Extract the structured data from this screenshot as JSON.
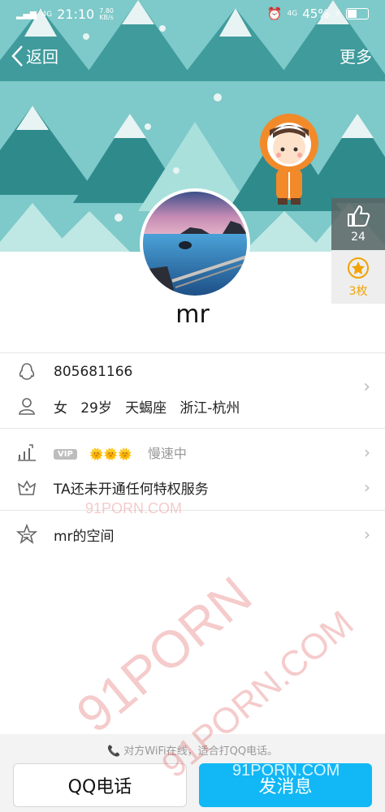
{
  "status_bar": {
    "network": "4G",
    "time": "21:10",
    "speed_value": "7.80",
    "speed_unit": "KB/s",
    "network_right": "4G",
    "battery": "45%"
  },
  "nav": {
    "back_label": "返回",
    "more_label": "更多"
  },
  "likes": {
    "count": "24",
    "stars": "3枚"
  },
  "profile": {
    "name": "mr",
    "qq_number": "805681166",
    "gender": "女",
    "age": "29岁",
    "zodiac": "天蝎座",
    "location": "浙江-杭州"
  },
  "vip": {
    "badge": "VIP",
    "suns": "🌞🌞🌞",
    "status": "慢速中",
    "privilege_text": "TA还未开通任何特权服务"
  },
  "space": {
    "label": "mr的空间"
  },
  "bottom": {
    "tip": "对方WiFi在线，适合打QQ电话。",
    "call_button": "QQ电话",
    "message_button": "发消息"
  },
  "watermarks": [
    "91PORN.COM",
    "91PORN",
    "91PORN.COM",
    "91PORN.COM"
  ],
  "colors": {
    "banner_bg": "#7ec9c9",
    "tree_dark": "#2f8a8c",
    "tree_light": "#a9e0dc",
    "accent_blue": "#12b7f5",
    "star_gold": "#f0a300"
  }
}
